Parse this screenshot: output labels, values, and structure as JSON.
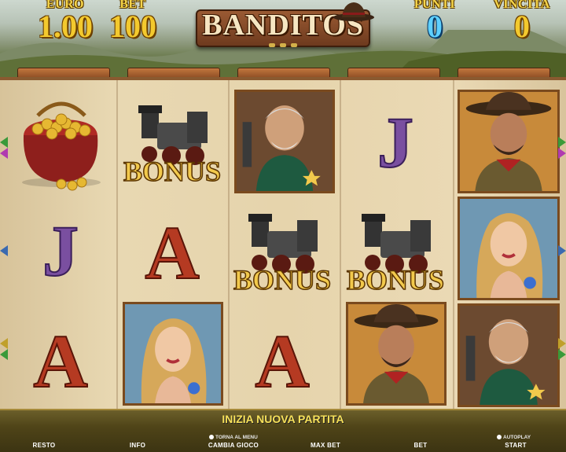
{
  "header": {
    "euro_label": "EURO",
    "euro_value": "1.00",
    "bet_label": "BET",
    "bet_value": "100",
    "punti_label": "PUNTI",
    "punti_value": "0",
    "vincita_label": "VINCITA",
    "vincita_value": "0",
    "logo": "BANDITOS"
  },
  "reels": {
    "symbols": [
      [
        "gold-bag",
        "J",
        "A"
      ],
      [
        "train-bonus",
        "A",
        "blonde-woman"
      ],
      [
        "old-bandit",
        "train-bonus",
        "A"
      ],
      [
        "J",
        "train-bonus",
        "cowboy"
      ],
      [
        "cowboy",
        "blonde-woman",
        "old-bandit"
      ]
    ],
    "bonus_text": "BONUS"
  },
  "bottom_bar": {
    "new_game": "INIZIA NUOVA PARTITA",
    "resto": "RESTO",
    "info": "INFO",
    "torna_al_menu": "TORNA AL MENU",
    "cambia_gioco": "CAMBIA GIOCO",
    "max_bet": "MAX BET",
    "bet": "BET",
    "autoplay": "AUTOPLAY",
    "start": "START"
  },
  "colors": {
    "gold": "#f3c92e",
    "blue_value": "#5ed0ff",
    "letter_purple": "#7a4fa0",
    "letter_red": "#b53a22",
    "bar_text": "#f7e15a"
  }
}
